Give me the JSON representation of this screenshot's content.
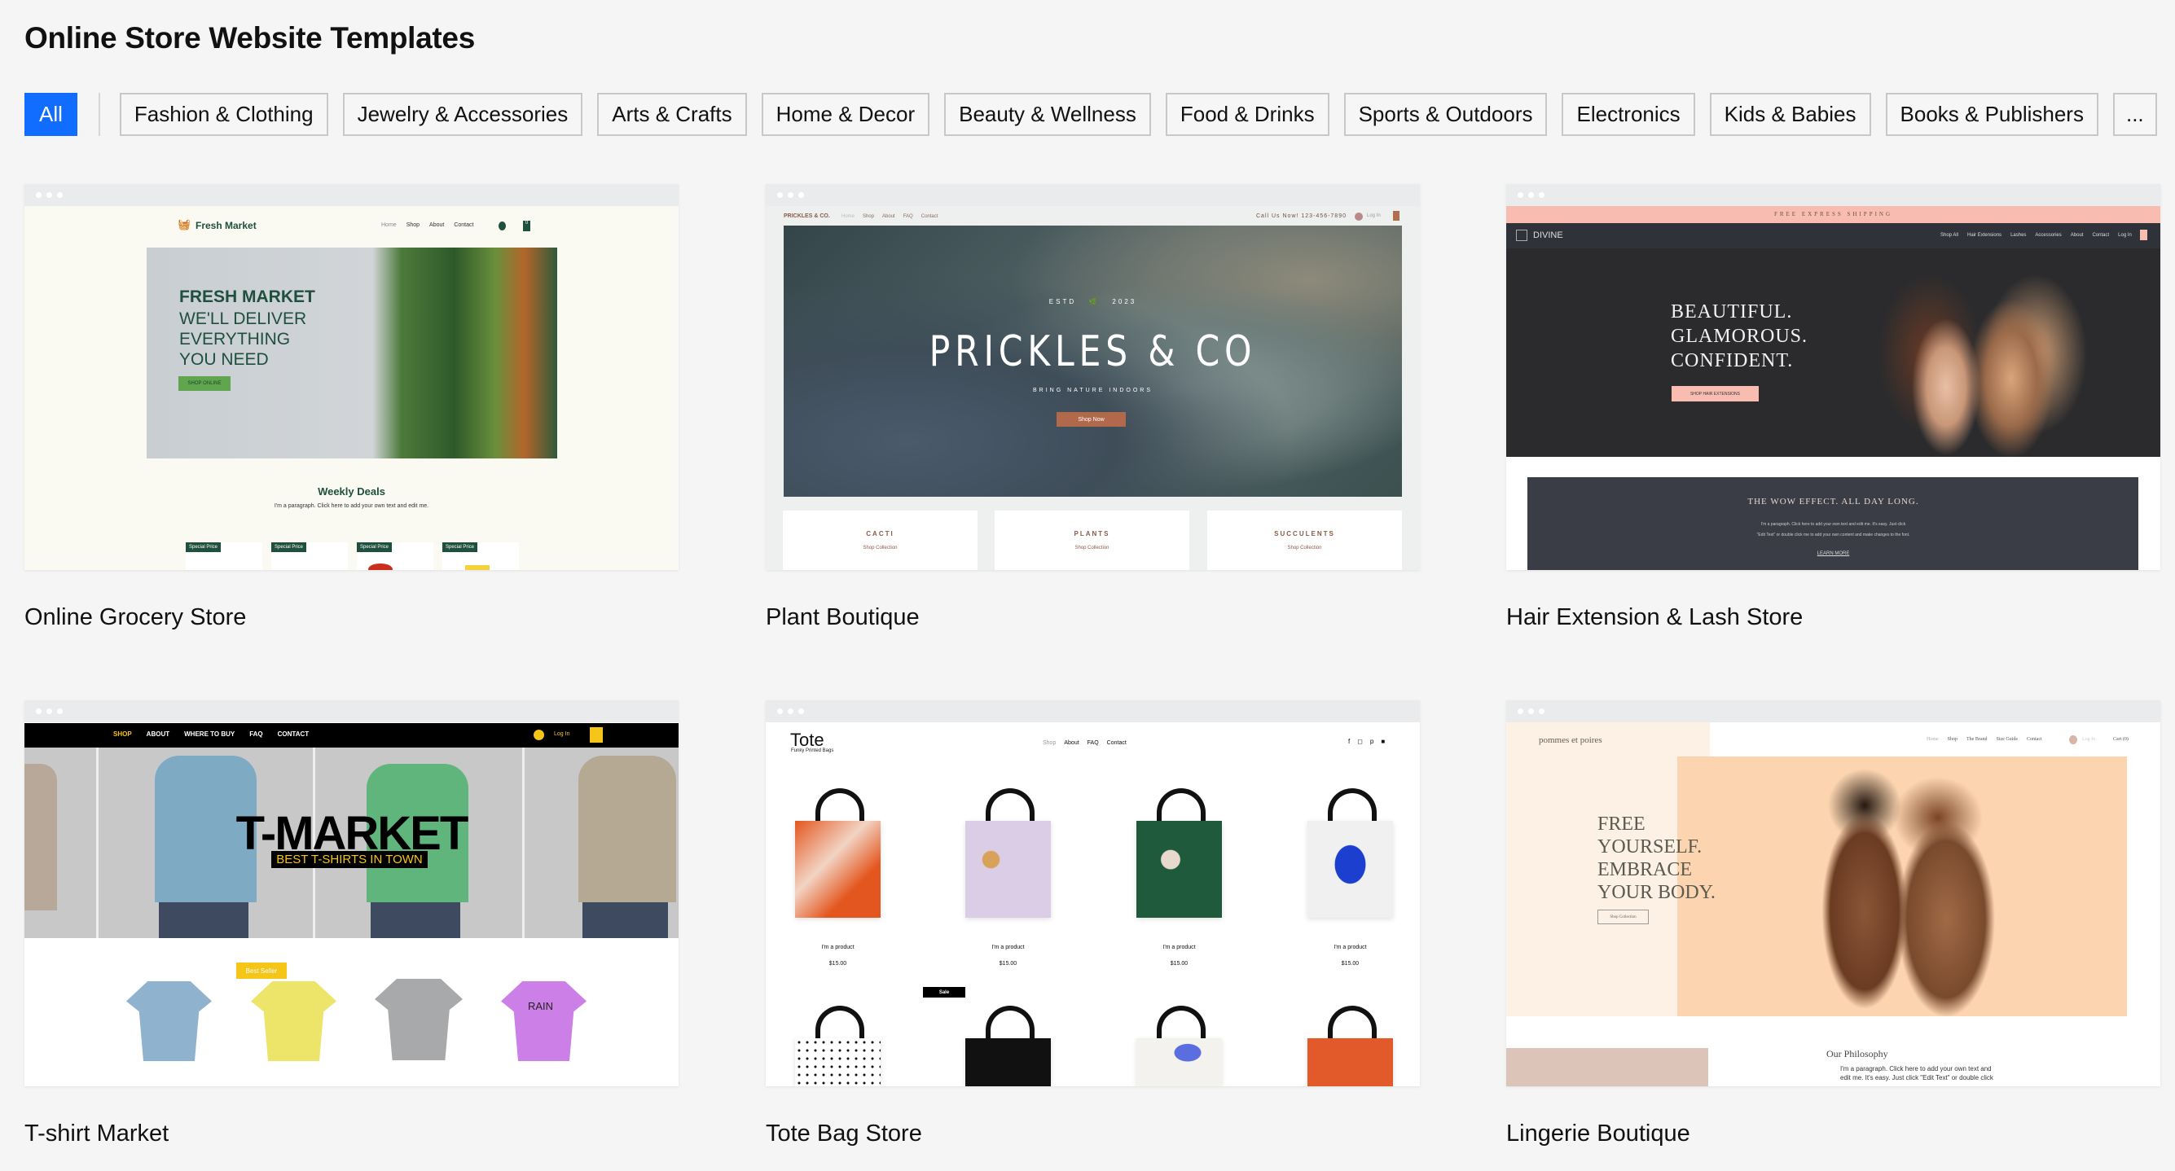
{
  "page_title": "Online Store Website Templates",
  "filters": [
    "All",
    "Fashion & Clothing",
    "Jewelry & Accessories",
    "Arts & Crafts",
    "Home & Decor",
    "Beauty & Wellness",
    "Food & Drinks",
    "Sports & Outdoors",
    "Electronics",
    "Kids & Babies",
    "Books & Publishers",
    "..."
  ],
  "active_filter": "All",
  "accent_color": "#116dff",
  "templates": [
    {
      "name": "Online Grocery Store",
      "site": {
        "logo": "Fresh Market",
        "nav": [
          "Home",
          "Shop",
          "About",
          "Contact"
        ],
        "hero_title": "FRESH MARKET",
        "hero_lines": [
          "WE'LL DELIVER",
          "EVERYTHING",
          "YOU NEED"
        ],
        "cta": "SHOP ONLINE",
        "section_title": "Weekly Deals",
        "paragraph": "I'm a paragraph. Click here to add your own text and edit me.",
        "badge": "Special Price",
        "cart_count": "0"
      }
    },
    {
      "name": "Plant Boutique",
      "site": {
        "logo": "PRICKLES & CO.",
        "nav": [
          "Home",
          "Shop",
          "About",
          "FAQ",
          "Contact"
        ],
        "phone": "Call Us Now! 123-456-7890",
        "login": "Log In",
        "estd": "ESTD",
        "year": "2023",
        "hero_title": "PRICKLES & CO",
        "tagline": "BRING NATURE INDOORS",
        "cta": "Shop Now",
        "collections": [
          "CACTI",
          "PLANTS",
          "SUCCULENTS"
        ],
        "collection_link": "Shop Collection"
      }
    },
    {
      "name": "Hair Extension & Lash Store",
      "site": {
        "banner": "FREE EXPRESS SHIPPING",
        "logo": "DIVINE",
        "nav": [
          "Shop All",
          "Hair Extensions",
          "Lashes",
          "Accessories",
          "About",
          "Contact"
        ],
        "login": "Log In",
        "hero_lines": [
          "BEAUTIFUL.",
          "GLAMOROUS.",
          "CONFIDENT."
        ],
        "cta": "SHOP HAIR EXTENSIONS",
        "section_title": "THE WOW EFFECT. ALL DAY LONG.",
        "paragraph_lines": [
          "I'm a paragraph. Click here to add your own text and edit me. It's easy. Just click",
          "\"Edit Text\" or double click me to add your own content and make changes to the font."
        ],
        "link": "LEARN MORE"
      }
    },
    {
      "name": "T-shirt Market",
      "site": {
        "nav": [
          "SHOP",
          "ABOUT",
          "WHERE TO BUY",
          "FAQ",
          "CONTACT"
        ],
        "login": "Log In",
        "hero_title": "T-MARKET",
        "hero_sub": "BEST T-SHIRTS IN TOWN",
        "badge": "Best Seller",
        "shirt_text": "RAIN"
      }
    },
    {
      "name": "Tote Bag Store",
      "site": {
        "logo": "Tote",
        "tagline": "Funky Printed Bags",
        "nav": [
          "Shop",
          "About",
          "FAQ",
          "Contact"
        ],
        "product": "I'm a product",
        "price": "$15.00",
        "sale": "Sale"
      }
    },
    {
      "name": "Lingerie Boutique",
      "site": {
        "logo": "pommes et poires",
        "nav": [
          "Home",
          "Shop",
          "The Brand",
          "Size Guide",
          "Contact"
        ],
        "login": "Log In",
        "cart": "Cart (0)",
        "hero_lines": [
          "FREE",
          "YOURSELF.",
          "EMBRACE",
          "YOUR BODY."
        ],
        "cta": "Shop Collection",
        "section_title": "Our Philosophy",
        "paragraph_lines": [
          "I'm a paragraph. Click here to add your own text and",
          "edit me. It's easy. Just click \"Edit Text\" or double click"
        ]
      }
    }
  ]
}
